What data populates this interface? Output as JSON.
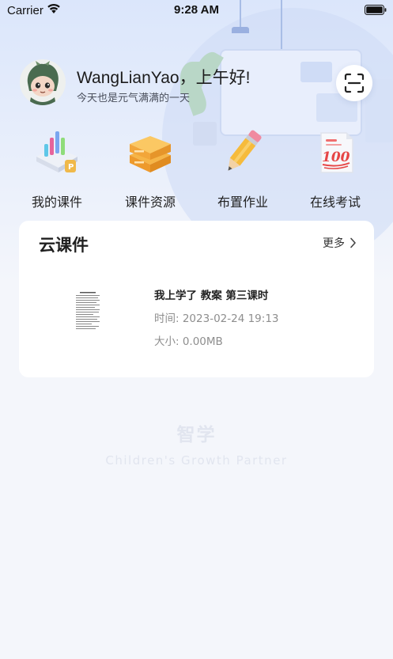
{
  "status_bar": {
    "carrier": "Carrier",
    "time": "9:28 AM"
  },
  "header": {
    "greeting": "WangLianYao，上午好!",
    "subtitle": "今天也是元气满满的一天",
    "scan_icon": "scan-icon"
  },
  "quick_menu": [
    {
      "label": "我的课件",
      "icon": "my-courseware-icon"
    },
    {
      "label": "课件资源",
      "icon": "courseware-resources-icon"
    },
    {
      "label": "布置作业",
      "icon": "assign-homework-icon"
    },
    {
      "label": "在线考试",
      "icon": "online-exam-icon"
    }
  ],
  "cloud_courseware": {
    "title": "云课件",
    "more_label": "更多",
    "items": [
      {
        "name": "我上学了 教案 第三课时",
        "time": "时间: 2023-02-24 19:13",
        "size": "大小: 0.00MB"
      }
    ]
  },
  "watermark": {
    "brand": "智学",
    "slogan": "Children's Growth Partner"
  },
  "colors": {
    "background": "#f4f6fb",
    "header_gradient_top": "#dbe6fb",
    "card": "#ffffff",
    "meta_text": "#8e8e8e"
  }
}
